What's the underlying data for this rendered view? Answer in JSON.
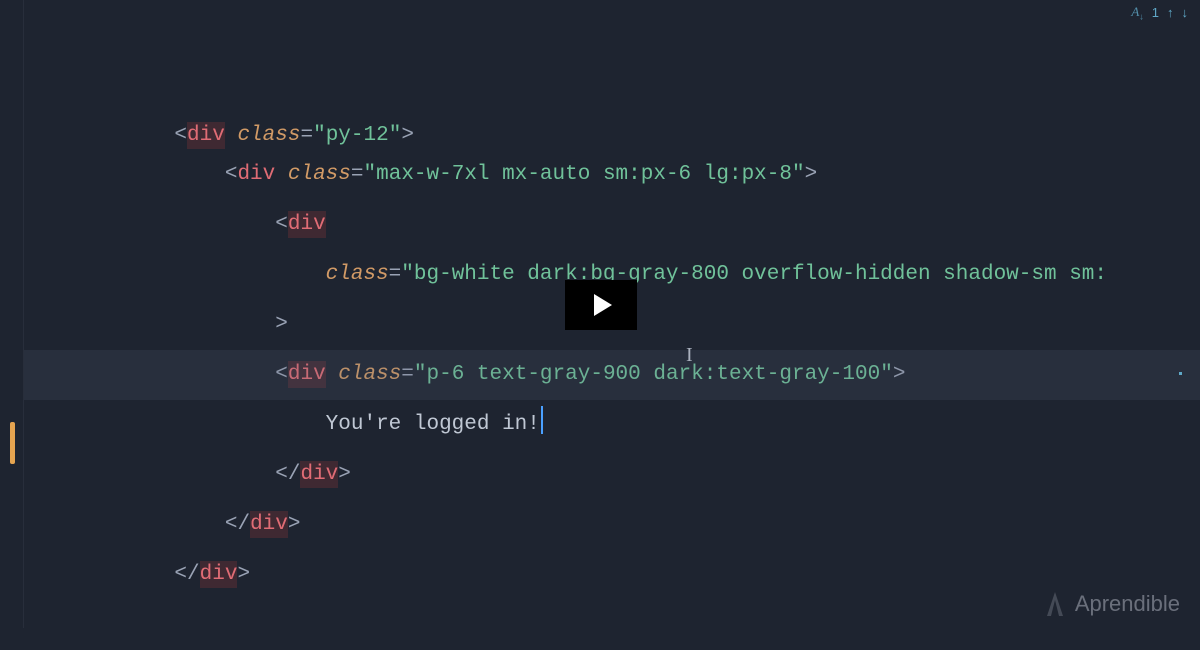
{
  "topbar": {
    "font_label": "A",
    "count": "1",
    "up": "↑",
    "down": "↓"
  },
  "code": {
    "line1": {
      "tag": "div",
      "attr": "class",
      "val": "py-12"
    },
    "line2": {
      "tag": "div",
      "attr": "class",
      "val": "max-w-7xl mx-auto sm:px-6 lg:px-8"
    },
    "line3": {
      "tag": "div"
    },
    "line4": {
      "attr": "class",
      "val": "bg-white dark:bg-gray-800 overflow-hidden shadow-sm sm:"
    },
    "line5": {
      "gt": ">"
    },
    "line6": {
      "tag": "div",
      "attr": "class",
      "val": "p-6 text-gray-900 dark:text-gray-100"
    },
    "line7": {
      "text": "You're logged in!"
    },
    "line8": {
      "tag": "div"
    },
    "line9": {
      "tag": "div"
    },
    "line10": {
      "tag": "div"
    }
  },
  "watermark": {
    "text": "Aprendible"
  }
}
